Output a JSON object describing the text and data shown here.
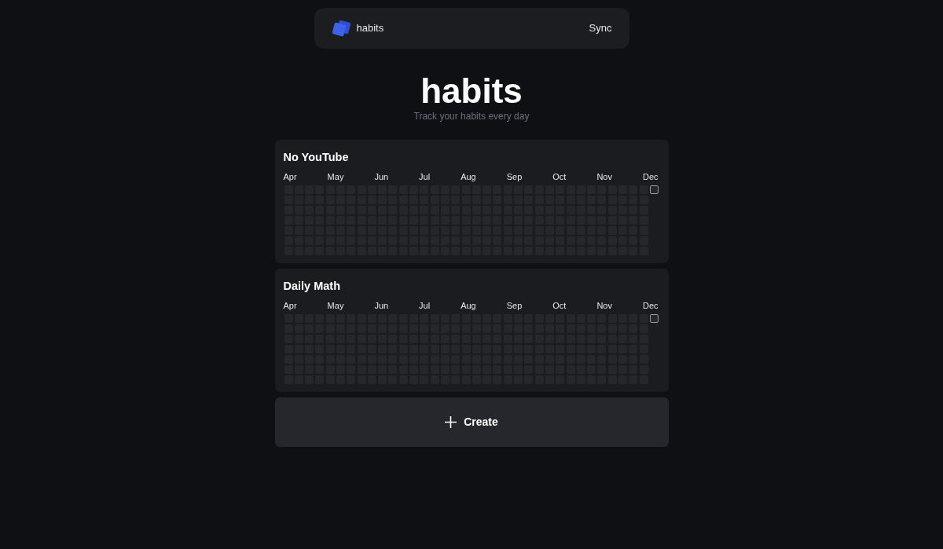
{
  "header": {
    "brand": "habits",
    "sync_button": "Sync"
  },
  "hero": {
    "title": "habits",
    "subtitle": "Track your habits every day"
  },
  "habits": [
    {
      "name": "No YouTube",
      "months": [
        "Apr",
        "May",
        "Jun",
        "Jul",
        "Aug",
        "Sep",
        "Oct",
        "Nov",
        "Dec"
      ],
      "weeks": [
        [
          false,
          false,
          false,
          false,
          false,
          false,
          false
        ],
        [
          false,
          false,
          false,
          false,
          false,
          false,
          false
        ],
        [
          false,
          false,
          false,
          false,
          false,
          false,
          false
        ],
        [
          false,
          false,
          false,
          false,
          false,
          false,
          false
        ],
        [
          false,
          false,
          false,
          false,
          false,
          false,
          false
        ],
        [
          false,
          false,
          false,
          false,
          false,
          false,
          false
        ],
        [
          false,
          false,
          false,
          false,
          false,
          false,
          false
        ],
        [
          false,
          false,
          false,
          false,
          false,
          false,
          false
        ],
        [
          false,
          false,
          false,
          false,
          false,
          false,
          false
        ],
        [
          false,
          false,
          false,
          false,
          false,
          false,
          false
        ],
        [
          false,
          false,
          false,
          false,
          false,
          false,
          false
        ],
        [
          false,
          false,
          false,
          false,
          false,
          false,
          false
        ],
        [
          false,
          false,
          false,
          false,
          false,
          false,
          false
        ],
        [
          false,
          false,
          false,
          false,
          false,
          false,
          false
        ],
        [
          false,
          false,
          false,
          false,
          false,
          false,
          false
        ],
        [
          false,
          false,
          false,
          false,
          false,
          false,
          false
        ],
        [
          false,
          false,
          false,
          false,
          false,
          false,
          false
        ],
        [
          false,
          false,
          false,
          false,
          false,
          false,
          false
        ],
        [
          false,
          false,
          false,
          false,
          false,
          false,
          false
        ],
        [
          false,
          false,
          false,
          false,
          false,
          false,
          false
        ],
        [
          false,
          false,
          false,
          false,
          false,
          false,
          false
        ],
        [
          false,
          false,
          false,
          false,
          false,
          false,
          false
        ],
        [
          false,
          false,
          false,
          false,
          false,
          false,
          false
        ],
        [
          false,
          false,
          false,
          false,
          false,
          false,
          false
        ],
        [
          false,
          false,
          false,
          false,
          false,
          false,
          false
        ],
        [
          false,
          false,
          false,
          false,
          false,
          false,
          false
        ],
        [
          false,
          false,
          false,
          false,
          false,
          false,
          false
        ],
        [
          false,
          false,
          false,
          false,
          false,
          false,
          false
        ],
        [
          false,
          false,
          false,
          false,
          false,
          false,
          false
        ],
        [
          false,
          false,
          false,
          false,
          false,
          false,
          false
        ],
        [
          false,
          false,
          false,
          false,
          false,
          false,
          false
        ],
        [
          false,
          false,
          false,
          false,
          false,
          false,
          false
        ],
        [
          false,
          false,
          false,
          false,
          false,
          false,
          false
        ],
        [
          false,
          false,
          false,
          false,
          false,
          false,
          false
        ],
        [
          false,
          false,
          false,
          false,
          false,
          false,
          false
        ]
      ],
      "today": {
        "checked": false
      }
    },
    {
      "name": "Daily Math",
      "months": [
        "Apr",
        "May",
        "Jun",
        "Jul",
        "Aug",
        "Sep",
        "Oct",
        "Nov",
        "Dec"
      ],
      "weeks": [
        [
          false,
          false,
          false,
          false,
          false,
          false,
          false
        ],
        [
          false,
          false,
          false,
          false,
          false,
          false,
          false
        ],
        [
          false,
          false,
          false,
          false,
          false,
          false,
          false
        ],
        [
          false,
          false,
          false,
          false,
          false,
          false,
          false
        ],
        [
          false,
          false,
          false,
          false,
          false,
          false,
          false
        ],
        [
          false,
          false,
          false,
          false,
          false,
          false,
          false
        ],
        [
          false,
          false,
          false,
          false,
          false,
          false,
          false
        ],
        [
          false,
          false,
          false,
          false,
          false,
          false,
          false
        ],
        [
          false,
          false,
          false,
          false,
          false,
          false,
          false
        ],
        [
          false,
          false,
          false,
          false,
          false,
          false,
          false
        ],
        [
          false,
          false,
          false,
          false,
          false,
          false,
          false
        ],
        [
          false,
          false,
          false,
          false,
          false,
          false,
          false
        ],
        [
          false,
          false,
          false,
          false,
          false,
          false,
          false
        ],
        [
          false,
          false,
          false,
          false,
          false,
          false,
          false
        ],
        [
          false,
          false,
          false,
          false,
          false,
          false,
          false
        ],
        [
          false,
          false,
          false,
          false,
          false,
          false,
          false
        ],
        [
          false,
          false,
          false,
          false,
          false,
          false,
          false
        ],
        [
          false,
          false,
          false,
          false,
          false,
          false,
          false
        ],
        [
          false,
          false,
          false,
          false,
          false,
          false,
          false
        ],
        [
          false,
          false,
          false,
          false,
          false,
          false,
          false
        ],
        [
          false,
          false,
          false,
          false,
          false,
          false,
          false
        ],
        [
          false,
          false,
          false,
          false,
          false,
          false,
          false
        ],
        [
          false,
          false,
          false,
          false,
          false,
          false,
          false
        ],
        [
          false,
          false,
          false,
          false,
          false,
          false,
          false
        ],
        [
          false,
          false,
          false,
          false,
          false,
          false,
          false
        ],
        [
          false,
          false,
          false,
          false,
          false,
          false,
          false
        ],
        [
          false,
          false,
          false,
          false,
          false,
          false,
          false
        ],
        [
          false,
          false,
          false,
          false,
          false,
          false,
          false
        ],
        [
          false,
          false,
          false,
          false,
          false,
          false,
          false
        ],
        [
          false,
          false,
          false,
          false,
          false,
          false,
          false
        ],
        [
          false,
          false,
          false,
          false,
          false,
          false,
          false
        ],
        [
          false,
          false,
          false,
          false,
          false,
          false,
          false
        ],
        [
          false,
          false,
          false,
          false,
          false,
          false,
          false
        ],
        [
          false,
          false,
          false,
          false,
          false,
          false,
          false
        ],
        [
          false,
          false,
          false,
          false,
          false,
          false,
          false
        ]
      ],
      "today": {
        "checked": false
      }
    }
  ],
  "create_button": "Create"
}
